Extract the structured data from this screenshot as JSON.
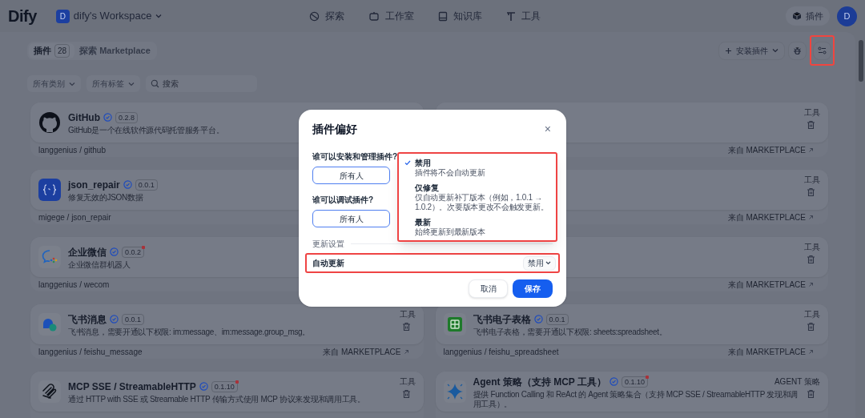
{
  "header": {
    "logo": "Dify",
    "workspace_initial": "D",
    "workspace": "dify's Workspace",
    "nav": [
      {
        "label": "探索"
      },
      {
        "label": "工作室"
      },
      {
        "label": "知识库"
      },
      {
        "label": "工具"
      }
    ],
    "plugins_button": "插件",
    "avatar": "D"
  },
  "toolbar": {
    "tabs": [
      {
        "label": "插件",
        "count": "28",
        "selected": true
      },
      {
        "label": "探索 Marketplace",
        "selected": false
      }
    ],
    "install_button": "安装插件"
  },
  "filters": {
    "category": "所有类别",
    "tags": "所有标签",
    "search_placeholder": "搜索"
  },
  "plugins": [
    {
      "name": "GitHub",
      "verified": true,
      "version": "0.2.8",
      "update_available": false,
      "description": "GitHub是一个在线软件源代码托管服务平台。",
      "path": "langgenius / github"
    },
    {
      "tag": "工具",
      "deletable": true,
      "source": "来自 MARKETPLACE"
    },
    {
      "name": "json_repair",
      "verified": true,
      "version": "0.0.1",
      "update_available": false,
      "description": "修复无效的JSON数据",
      "path": "migege / json_repair"
    },
    {
      "tag": "工具",
      "deletable": true,
      "source": "来自 MARKETPLACE"
    },
    {
      "name": "企业微信",
      "verified": true,
      "version": "0.0.2",
      "update_available": true,
      "description": "企业微信群机器人",
      "path": "langgenius / wecom"
    },
    {
      "tag": "工具",
      "deletable": true,
      "source": "来自 MARKETPLACE"
    },
    {
      "name": "飞书消息",
      "verified": true,
      "version": "0.0.1",
      "update_available": false,
      "description": "飞书消息，需要开通以下权限: im:message、im:message.group_msg。",
      "path": "langgenius / feishu_message",
      "tag": "工具",
      "deletable": true,
      "source": "来自 MARKETPLACE"
    },
    {
      "name": "飞书电子表格",
      "verified": true,
      "version": "0.0.1",
      "update_available": false,
      "description": "飞书电子表格，需要开通以下权限: sheets:spreadsheet。",
      "path": "langgenius / feishu_spreadsheet",
      "tag": "工具",
      "deletable": true,
      "source": "来自 MARKETPLACE"
    },
    {
      "name": "MCP SSE / StreamableHTTP",
      "verified": true,
      "version": "0.1.10",
      "update_available": true,
      "description": "通过 HTTP with SSE 或 Streamable HTTP 传输方式使用 MCP 协议来发现和调用工具。",
      "tag": "工具",
      "deletable": true
    },
    {
      "name": "Agent 策略（支持 MCP 工具）",
      "verified": true,
      "version": "0.1.10",
      "update_available": true,
      "description": "提供 Function Calling 和 ReAct 的 Agent 策略集合（支持 MCP SSE / StreamableHTTP 发现和调用工具）。",
      "tag": "AGENT 策略",
      "deletable": true
    }
  ],
  "preferences_dialog": {
    "title": "插件偏好",
    "close": "×",
    "permissions": [
      {
        "label": "谁可以安装和管理插件?",
        "options": [
          {
            "label": "所有人",
            "selected": true
          }
        ]
      },
      {
        "label": "谁可以调试插件?",
        "options": [
          {
            "label": "所有人",
            "selected": true
          }
        ]
      }
    ],
    "update_section": "更新设置",
    "auto_update": {
      "label": "自动更新",
      "value": "禁用"
    },
    "update_menu": [
      {
        "label": "禁用",
        "description": "插件将不会自动更新",
        "selected": true
      },
      {
        "label": "仅修复",
        "description": "仅自动更新补丁版本（例如，1.0.1 → 1.0.2）。次要版本更改不会触发更新。",
        "selected": false
      },
      {
        "label": "最新",
        "description": "始终更新到最新版本",
        "selected": false
      }
    ],
    "buttons": {
      "cancel": "取消",
      "save": "保存"
    }
  }
}
